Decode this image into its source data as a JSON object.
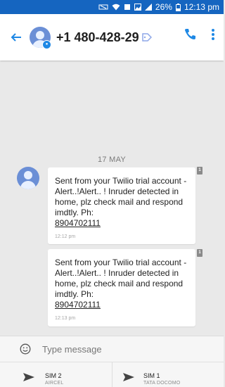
{
  "status_bar": {
    "battery": "26%",
    "time": "12:13 pm"
  },
  "app_bar": {
    "contact_number": "+1 480-428-29"
  },
  "conversation": {
    "date_separator": "17 MAY",
    "messages": [
      {
        "text": "Sent from your Twilio trial account - Alert..!Alert.. ! Inruder detected in home, plz check mail and respond imdtly. Ph: ",
        "phone": "8904702111",
        "time": "12:12 pm",
        "sim": "1"
      },
      {
        "text": "Sent from your Twilio trial account - Alert..!Alert.. ! Inruder detected in home, plz check mail and respond imdtly. Ph: ",
        "phone": "8904702111",
        "time": "12:13 pm",
        "sim": "1"
      }
    ]
  },
  "compose": {
    "placeholder": "Type message"
  },
  "send_options": [
    {
      "sim": "SIM 2",
      "carrier": "AIRCEL"
    },
    {
      "sim": "SIM 1",
      "carrier": "TATA DOCOMO"
    }
  ],
  "colors": {
    "accent": "#1e88e5",
    "status_bar": "#1565c0",
    "background": "#e9e9e9"
  }
}
